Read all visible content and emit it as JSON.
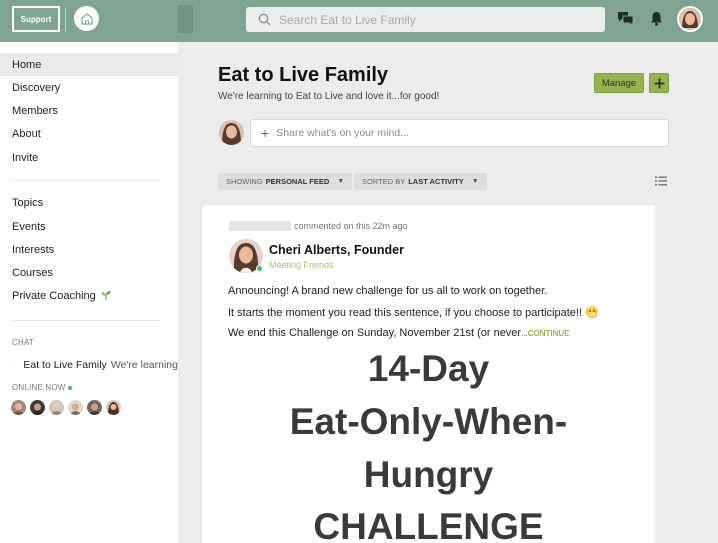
{
  "header": {
    "support_label": "Support",
    "search_placeholder": "Search Eat to Live Family",
    "icons": {
      "chat": "chat-bubbles-icon",
      "bell": "bell-icon",
      "search": "search-icon",
      "home": "home-logo-icon"
    }
  },
  "sidebar": {
    "nav": [
      {
        "label": "Home",
        "active": true
      },
      {
        "label": "Discovery"
      },
      {
        "label": "Members"
      },
      {
        "label": "About"
      },
      {
        "label": "Invite"
      }
    ],
    "nav2": [
      {
        "label": "Topics"
      },
      {
        "label": "Events"
      },
      {
        "label": "Interests"
      },
      {
        "label": "Courses"
      },
      {
        "label": "Private Coaching"
      }
    ],
    "chat_label": "CHAT",
    "chat_room": {
      "name": "Eat to Live Family",
      "preview": "We're learning"
    },
    "online_label": "ONLINE NOW"
  },
  "main": {
    "title": "Eat to Live Family",
    "subtitle": "We're learning to Eat to Live and love it...for good!",
    "manage_label": "Manage",
    "add_label": "+",
    "composer_placeholder": "Share what's on your mind...",
    "filters": {
      "feed_prefix": "SHOWING",
      "feed_value": "PERSONAL FEED",
      "sort_prefix": "SORTED BY",
      "sort_value": "LAST ACTIVITY"
    }
  },
  "post": {
    "activity": "commented on this 22m ago",
    "author": "Cheri Alberts, Founder",
    "group": "Meeting Friends",
    "lines": [
      "Announcing! A brand new challenge for us all to work on together.",
      "It starts the moment you read this sentence, if you choose to participate!!",
      "We end this Challenge on Sunday, November 21st (or never"
    ],
    "continue_label": "...CONTINUE",
    "emoji": "😁",
    "graphic_lines": [
      "14-Day",
      "Eat-Only-When-",
      "Hungry",
      "CHALLENGE"
    ]
  },
  "colors": {
    "topbar": "#7fa592",
    "accent_green": "#98b24e",
    "online_green": "#3fc06b"
  }
}
